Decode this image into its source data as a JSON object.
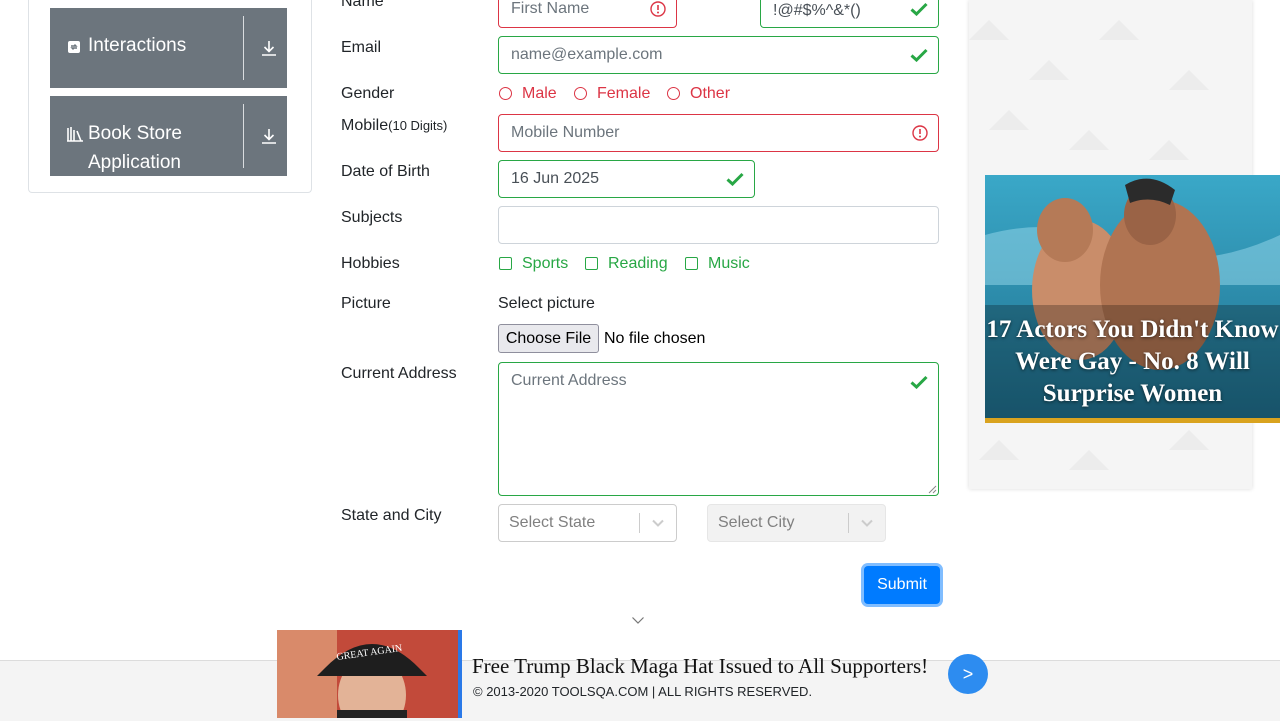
{
  "sidebar": {
    "groups": [
      {
        "label": "Interactions",
        "icon": "interactions-icon"
      },
      {
        "label": "Book Store",
        "label2": "Application",
        "icon": "books-icon"
      }
    ]
  },
  "form": {
    "name_label": "Name",
    "first_name_placeholder": "First Name",
    "last_name_value": "!@#$%^&*()",
    "email_label": "Email",
    "email_placeholder": "name@example.com",
    "gender_label": "Gender",
    "gender_options": [
      "Male",
      "Female",
      "Other"
    ],
    "mobile_label": "Mobile",
    "mobile_hint": "(10 Digits)",
    "mobile_placeholder": "Mobile Number",
    "dob_label": "Date of Birth",
    "dob_value": "16 Jun 2025",
    "subjects_label": "Subjects",
    "hobbies_label": "Hobbies",
    "hobbies_options": [
      "Sports",
      "Reading",
      "Music"
    ],
    "picture_label": "Picture",
    "select_picture": "Select picture",
    "choose_file": "Choose File",
    "no_file": "No file chosen",
    "address_label": "Current Address",
    "address_placeholder": "Current Address",
    "state_city_label": "State and City",
    "state_placeholder": "Select State",
    "city_placeholder": "Select City",
    "submit": "Submit"
  },
  "ad": {
    "title": "17 Actors You Didn't Know Were Gay - No. 8 Will Surprise Women"
  },
  "footer": {
    "banner_text": "Free Trump Black Maga Hat Issued to All Supporters!",
    "copyright": "© 2013-2020 TOOLSQA.COM | ALL RIGHTS RESERVED.",
    "arrow": ">",
    "cap_text": "GREAT AGAIN"
  },
  "colors": {
    "valid": "#28a745",
    "invalid": "#dc3545",
    "primary": "#007bff",
    "sidebar_group": "#6c757d"
  }
}
